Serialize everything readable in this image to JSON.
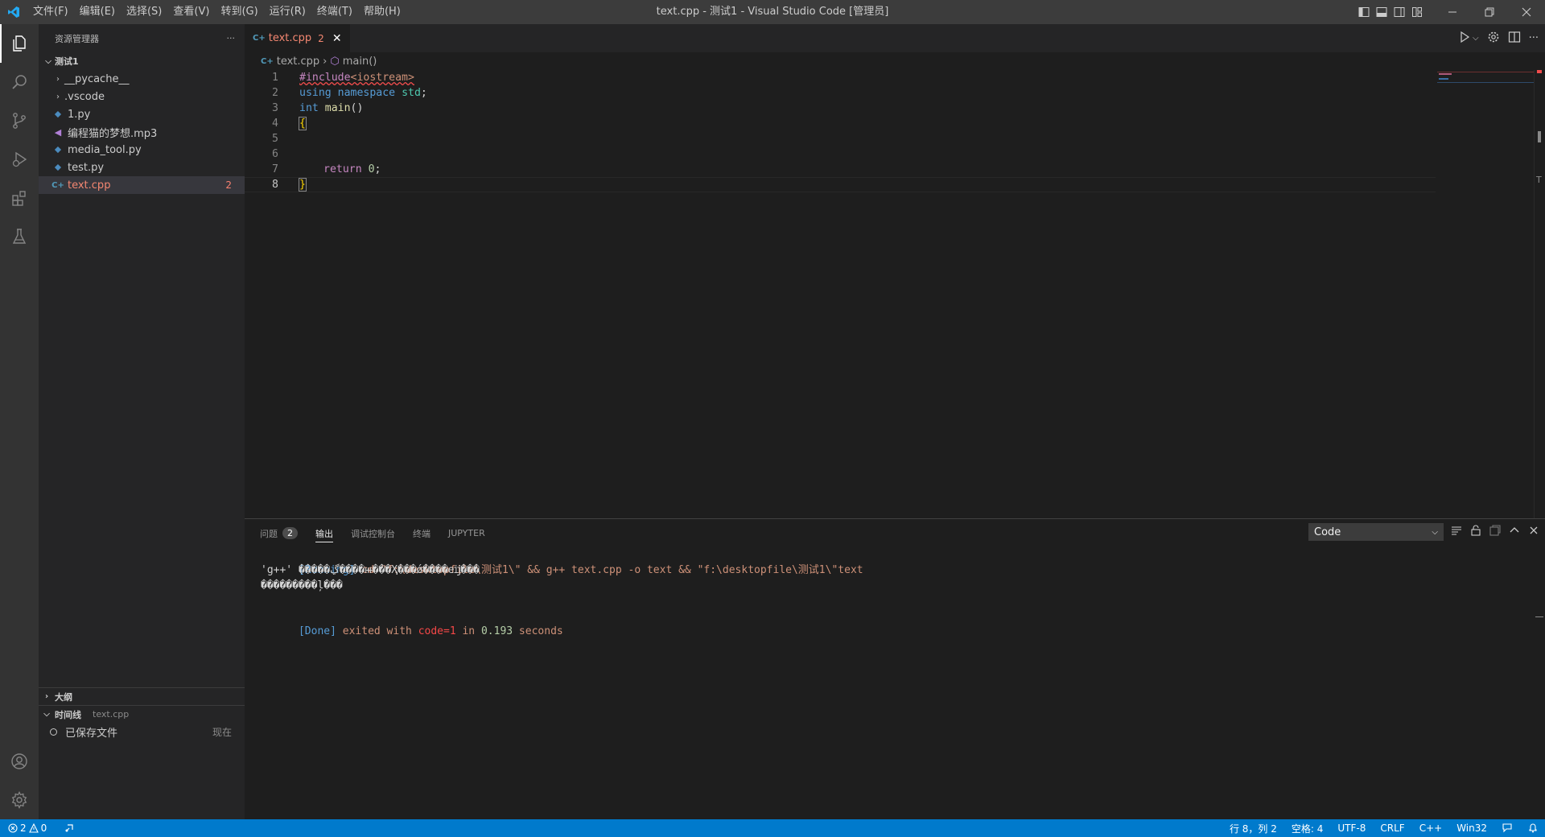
{
  "window": {
    "title": "text.cpp - 测试1 - Visual Studio Code [管理员]",
    "menu": [
      "文件(F)",
      "编辑(E)",
      "选择(S)",
      "查看(V)",
      "转到(G)",
      "运行(R)",
      "终端(T)",
      "帮助(H)"
    ]
  },
  "activity_bar": {
    "items": [
      "files-icon",
      "search-icon",
      "source-control-icon",
      "run-debug-icon",
      "extensions-icon",
      "testing-icon"
    ],
    "bottom": [
      "account-icon",
      "manage-gear-icon"
    ]
  },
  "explorer": {
    "header": "资源管理器",
    "more": "···",
    "root": "测试1",
    "items": [
      {
        "name": "__pycache__",
        "type": "folder"
      },
      {
        "name": ".vscode",
        "type": "folder"
      },
      {
        "name": "1.py",
        "type": "python"
      },
      {
        "name": "编程猫的梦想.mp3",
        "type": "audio"
      },
      {
        "name": "media_tool.py",
        "type": "python"
      },
      {
        "name": "test.py",
        "type": "python"
      },
      {
        "name": "text.cpp",
        "type": "cpp",
        "problems": "2"
      }
    ],
    "outline_label": "大纲",
    "timeline_label": "时间线",
    "timeline_file": "text.cpp",
    "timeline_entry": "已保存文件",
    "timeline_time": "现在"
  },
  "editor": {
    "tab_icon": "C+",
    "tab_name": "text.cpp",
    "tab_problems": "2",
    "tab_close": "✕",
    "breadcrumb_file": "text.cpp",
    "breadcrumb_symbol": "main()",
    "line_numbers": [
      "1",
      "2",
      "3",
      "4",
      "5",
      "6",
      "7",
      "8"
    ],
    "code": {
      "l1_directive": "#include",
      "l1_header": "<iostream>",
      "l2_using": "using",
      "l2_namespace": "namespace",
      "l2_std": "std",
      "l2_semi": ";",
      "l3_int": "int",
      "l3_main": "main",
      "l3_parens": "()",
      "l4_open": "{",
      "l7_return": "return",
      "l7_zero": "0",
      "l7_semi": ";",
      "l8_close": "}"
    }
  },
  "panel": {
    "tabs": [
      "问题",
      "输出",
      "调试控制台",
      "终端",
      "JUPYTER"
    ],
    "problems_badge": "2",
    "active_tab": "输出",
    "output_channel": "Code",
    "output": {
      "running_tag": "[Running]",
      "running_cmd": " cd \"f:\\desktopfile\\测试1\\\" && g++ text.cpp -o text && \"f:\\desktopfile\\测试1\\\"text",
      "err1": "'g++' �����ڲ����ⲿ���Ҳ���ǿ����еĳ���",
      "err2": "���������ļ���",
      "done_tag": "[Done]",
      "done_a": " exited with ",
      "done_code": "code=1",
      "done_b": " in ",
      "done_secs": "0.193",
      "done_c": " seconds"
    }
  },
  "status_bar": {
    "errors": "2",
    "warnings": "0",
    "position": "行 8，列 2",
    "indent": "空格: 4",
    "encoding": "UTF-8",
    "eol": "CRLF",
    "language": "C++",
    "platform": "Win32"
  },
  "colors": {
    "accent": "#007acc",
    "error": "#f48771",
    "titlebar": "#3c3c3c",
    "sidebar": "#252526",
    "editor": "#1e1e1e"
  }
}
